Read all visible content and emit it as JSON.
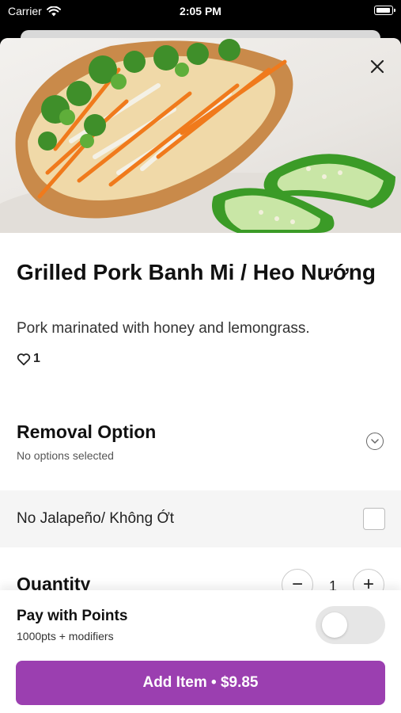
{
  "status_bar": {
    "carrier": "Carrier",
    "time": "2:05 PM"
  },
  "item": {
    "name": "Grilled Pork Banh Mi / Heo Nướng",
    "description": "Pork marinated with honey and lemongrass.",
    "likes": "1"
  },
  "removal_option": {
    "title": "Removal Option",
    "status": "No options selected",
    "options": [
      {
        "label": "No Jalapeño/ Không Ớt",
        "checked": false
      }
    ]
  },
  "quantity": {
    "title": "Quantity",
    "value": "1",
    "decrease": "−",
    "increase": "+"
  },
  "points": {
    "title": "Pay with Points",
    "subtitle": "1000pts + modifiers",
    "enabled": false
  },
  "add_button": {
    "label": "Add Item • $9.85"
  },
  "colors": {
    "accent": "#9b3fb0",
    "toggle_off": "#e6e6e6"
  }
}
